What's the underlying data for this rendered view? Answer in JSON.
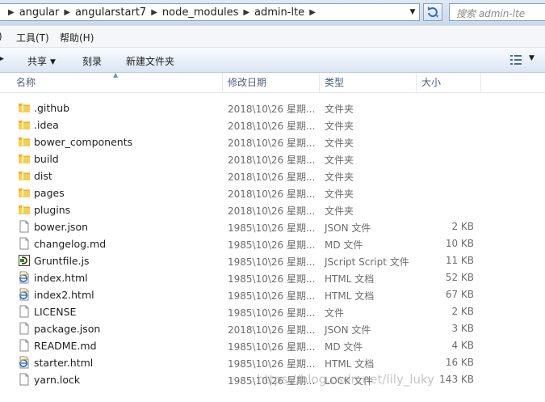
{
  "address_bar": {
    "breadcrumbs": [
      "angular",
      "angularstart7",
      "node_modules",
      "admin-lte"
    ],
    "search_placeholder": "搜索 admin-lte"
  },
  "menu": {
    "tools": "工具(T)",
    "help": "帮助(H)"
  },
  "commands": {
    "share": "共享",
    "burn": "刻录",
    "new_folder": "新建文件夹"
  },
  "columns": {
    "name": "名称",
    "modified": "修改日期",
    "type": "类型",
    "size": "大小"
  },
  "files": [
    {
      "name": ".github",
      "modified": "2018\\10\\26 星期...",
      "type": "文件夹",
      "size": "",
      "icon": "folder-icon"
    },
    {
      "name": ".idea",
      "modified": "2018\\10\\26 星期...",
      "type": "文件夹",
      "size": "",
      "icon": "folder-icon"
    },
    {
      "name": "bower_components",
      "modified": "2018\\10\\26 星期...",
      "type": "文件夹",
      "size": "",
      "icon": "folder-icon"
    },
    {
      "name": "build",
      "modified": "2018\\10\\26 星期...",
      "type": "文件夹",
      "size": "",
      "icon": "folder-icon"
    },
    {
      "name": "dist",
      "modified": "2018\\10\\26 星期...",
      "type": "文件夹",
      "size": "",
      "icon": "folder-icon"
    },
    {
      "name": "pages",
      "modified": "2018\\10\\26 星期...",
      "type": "文件夹",
      "size": "",
      "icon": "folder-icon"
    },
    {
      "name": "plugins",
      "modified": "2018\\10\\26 星期...",
      "type": "文件夹",
      "size": "",
      "icon": "folder-icon"
    },
    {
      "name": "bower.json",
      "modified": "1985\\10\\26 星期...",
      "type": "JSON 文件",
      "size": "2 KB",
      "icon": "file-icon"
    },
    {
      "name": "changelog.md",
      "modified": "1985\\10\\26 星期...",
      "type": "MD 文件",
      "size": "10 KB",
      "icon": "file-icon"
    },
    {
      "name": "Gruntfile.js",
      "modified": "1985\\10\\26 星期...",
      "type": "JScript Script 文件",
      "size": "11 KB",
      "icon": "script-icon"
    },
    {
      "name": "index.html",
      "modified": "1985\\10\\26 星期...",
      "type": "HTML 文档",
      "size": "52 KB",
      "icon": "html-icon"
    },
    {
      "name": "index2.html",
      "modified": "1985\\10\\26 星期...",
      "type": "HTML 文档",
      "size": "67 KB",
      "icon": "html-icon"
    },
    {
      "name": "LICENSE",
      "modified": "1985\\10\\26 星期...",
      "type": "文件",
      "size": "2 KB",
      "icon": "file-icon"
    },
    {
      "name": "package.json",
      "modified": "2018\\10\\26 星期...",
      "type": "JSON 文件",
      "size": "3 KB",
      "icon": "file-icon"
    },
    {
      "name": "README.md",
      "modified": "1985\\10\\26 星期...",
      "type": "MD 文件",
      "size": "4 KB",
      "icon": "file-icon"
    },
    {
      "name": "starter.html",
      "modified": "1985\\10\\26 星期...",
      "type": "HTML 文档",
      "size": "16 KB",
      "icon": "html-icon"
    },
    {
      "name": "yarn.lock",
      "modified": "1985\\10\\26 星期...",
      "type": "LOCK 文件",
      "size": "143 KB",
      "icon": "file-icon"
    }
  ],
  "watermark": "https://blog.csdn.net/lily_luky"
}
